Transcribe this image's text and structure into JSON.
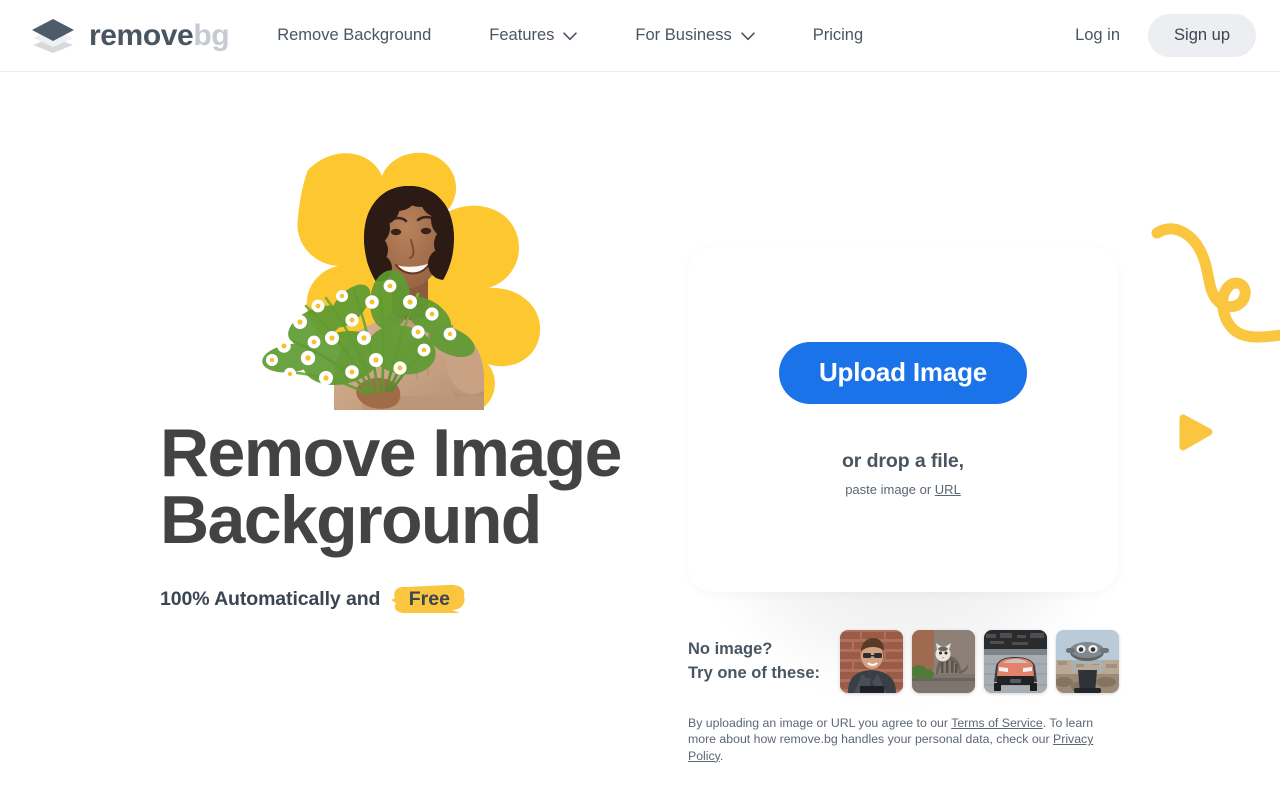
{
  "brand": {
    "word1": "remove",
    "word2": "bg",
    "logo_icon": "layers-diamond-icon"
  },
  "nav": {
    "items": [
      {
        "label": "Remove Background",
        "has_chevron": false
      },
      {
        "label": "Features",
        "has_chevron": true
      },
      {
        "label": "For Business",
        "has_chevron": true
      },
      {
        "label": "Pricing",
        "has_chevron": false
      }
    ],
    "login_label": "Log in",
    "signup_label": "Sign up"
  },
  "hero": {
    "headline": "Remove Image\nBackground",
    "subline": "100% Automatically and",
    "free_badge": "Free",
    "image_alt": "woman-holding-flowers-photo"
  },
  "upload": {
    "button_label": "Upload Image",
    "drop_text": "or drop a file,",
    "paste_prefix": "paste image or ",
    "paste_link": "URL"
  },
  "samples": {
    "label_line1": "No image?",
    "label_line2": "Try one of these:",
    "thumbnails": [
      {
        "name": "sample-man-glasses-brick-wall"
      },
      {
        "name": "sample-cat-on-ledge"
      },
      {
        "name": "sample-orange-sports-car"
      },
      {
        "name": "sample-tower-viewer-binoculars"
      }
    ]
  },
  "legal": {
    "part1": "By uploading an image or URL you agree to our ",
    "link1": "Terms of Service",
    "part2": ". To learn more about how remove.bg handles your personal data, check our ",
    "link2": "Privacy Policy",
    "part3": "."
  },
  "colors": {
    "accent_blue": "#1a73e8",
    "accent_yellow": "#fbc63f",
    "text_dark": "#434343",
    "text_muted": "#4a5562",
    "signup_bg": "#eceef1"
  },
  "decor": {
    "squiggle": "yellow-squiggle-line",
    "triangle": "yellow-play-triangle"
  }
}
